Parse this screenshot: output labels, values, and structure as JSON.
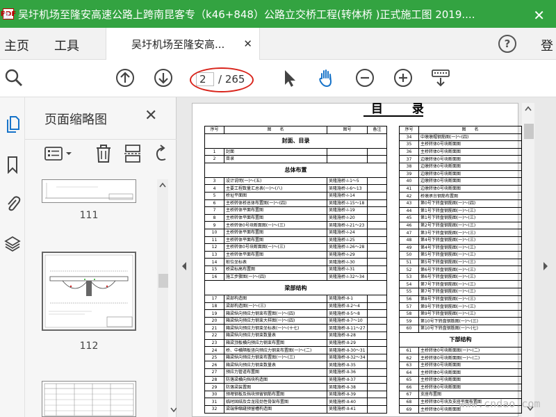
{
  "window": {
    "title": "吴圩机场至隆安高速公路上跨南昆客专（k46+848）公路立交桥工程(转体桥 )正式施工图 2019....",
    "app_icon": "PDF",
    "close_glyph": "✕",
    "corner_watermark": "建"
  },
  "menu": {
    "home": "主页",
    "tools": "工具",
    "doc_tab": "吴圩机场至隆安高...",
    "doc_tab_close": "✕",
    "help": "?",
    "login": "登"
  },
  "toolbar": {
    "current_page": "2",
    "total_pages": "/ 265"
  },
  "thumbnails": {
    "title": "页面缩略图",
    "close": "✕",
    "pages": [
      "111",
      "112"
    ]
  },
  "document": {
    "heading": "目 录",
    "left_headers": [
      "序号",
      "图　　名",
      "图号",
      "备注"
    ],
    "right_headers": [
      "序号",
      "图　　名"
    ],
    "left_rows": [
      {
        "section": "封面、目录"
      },
      {
        "no": "1",
        "name": "封面",
        "code": ""
      },
      {
        "no": "2",
        "name": "目录",
        "code": ""
      },
      {
        "section": "总体布置"
      },
      {
        "no": "3",
        "name": "设计说明(一)～(五)",
        "code": "吴隆施桥-Ⅰ-1～5"
      },
      {
        "no": "4",
        "name": "主要工程数量汇总表(一)～(八)",
        "code": "吴隆施桥-Ⅰ-6～13"
      },
      {
        "no": "5",
        "name": "桥址平面图",
        "code": "吴隆施桥-Ⅰ-14"
      },
      {
        "no": "6",
        "name": "主桥转体桥总体布置图(一)～(四)",
        "code": "吴隆施桥-Ⅰ-15～18"
      },
      {
        "no": "7",
        "name": "主桥转体平面布置图",
        "code": "吴隆施桥-Ⅰ-19"
      },
      {
        "no": "8",
        "name": "主桥转体平面布置图",
        "code": "吴隆施桥-Ⅰ-20"
      },
      {
        "no": "9",
        "name": "主桥转体0号块断面图(一)～(三)",
        "code": "吴隆施桥-Ⅰ-21～23"
      },
      {
        "no": "10",
        "name": "主桥转体平面布置图",
        "code": "吴隆施桥-Ⅰ-24"
      },
      {
        "no": "11",
        "name": "主桥转体平面布置图",
        "code": "吴隆施桥-Ⅰ-25"
      },
      {
        "no": "12",
        "name": "主桥转体0号块断面图(一)～(三)",
        "code": "吴隆施桥-Ⅰ-26～28"
      },
      {
        "no": "13",
        "name": "主桥转体平面布置图",
        "code": "吴隆施桥-Ⅰ-29"
      },
      {
        "no": "14",
        "name": "桩位坐标表",
        "code": "吴隆施桥-Ⅰ-30"
      },
      {
        "no": "15",
        "name": "桥梁标高布置图",
        "code": "吴隆施桥-Ⅰ-31"
      },
      {
        "no": "16",
        "name": "施工步骤图(一)～(四)",
        "code": "吴隆施桥-Ⅰ-32～34"
      },
      {
        "section": "梁部结构"
      },
      {
        "no": "17",
        "name": "梁部构造图",
        "code": "吴隆施桥-Ⅱ-1"
      },
      {
        "no": "18",
        "name": "梁部构造图(一)～(三)",
        "code": "吴隆施桥-Ⅱ-2～4"
      },
      {
        "no": "19",
        "name": "箱梁纵向预应力钢束布置图(一)～(四)",
        "code": "吴隆施桥-Ⅱ-5～8"
      },
      {
        "no": "20",
        "name": "箱梁纵向预应力钢束大样图(一)～(四)",
        "code": "吴隆施桥-Ⅱ-7～10"
      },
      {
        "no": "21",
        "name": "箱梁纵向预应力钢束坐标表(一)～(十七)",
        "code": "吴隆施桥-Ⅱ-11～27"
      },
      {
        "no": "22",
        "name": "箱梁纵向预应力钢束数量表",
        "code": "吴隆施桥-Ⅱ-28"
      },
      {
        "no": "23",
        "name": "箱梁顶板横向预应力钢束布置图",
        "code": "吴隆施桥-Ⅱ-29"
      },
      {
        "no": "24",
        "name": "桥、中横隔板竖向预应力钢束布置图(一)～(二)",
        "code": "吴隆施桥-Ⅱ-30～31"
      },
      {
        "no": "25",
        "name": "箱梁纵向预应力钢束布置图(一)～(三)",
        "code": "吴隆施桥-Ⅱ-32～34"
      },
      {
        "no": "26",
        "name": "箱梁纵向预应力钢束数量表",
        "code": "吴隆施桥-Ⅱ-35"
      },
      {
        "no": "27",
        "name": "预应力管道布置图",
        "code": "吴隆施桥-Ⅱ-36"
      },
      {
        "no": "28",
        "name": "防落梁横向挡块构造图",
        "code": "吴隆施桥-Ⅱ-37"
      },
      {
        "no": "29",
        "name": "防落梁装置图",
        "code": "吴隆施桥-Ⅱ-38"
      },
      {
        "no": "30",
        "name": "预埋钢板及挡块预留钢筋布置图",
        "code": "吴隆施桥-Ⅱ-39"
      },
      {
        "no": "31",
        "name": "临时固结及合龙段劲性骨架布置图",
        "code": "吴隆施桥-Ⅱ-40"
      },
      {
        "no": "32",
        "name": "梁端伸缩缝预留槽构造图",
        "code": "吴隆施桥-Ⅱ-41"
      }
    ],
    "right_rows": [
      {
        "no": "34",
        "name": "中墩墩帽钢筋图(一)～(四)"
      },
      {
        "no": "35",
        "name": "主桥转体0号块断面图"
      },
      {
        "no": "36",
        "name": "主桥转体0号块断面图"
      },
      {
        "no": "37",
        "name": "边墩转体0号块断面图"
      },
      {
        "no": "38",
        "name": "边墩转体0号块断面图"
      },
      {
        "no": "39",
        "name": "边墩转体0号块断面图"
      },
      {
        "no": "40",
        "name": "边墩转体0号块断面图"
      },
      {
        "no": "41",
        "name": "边墩转体0号块断面图"
      },
      {
        "no": "42",
        "name": "桥墩承台钢筋布置图"
      },
      {
        "no": "43",
        "name": "第0号下转盘钢筋图(一)～(四)"
      },
      {
        "no": "44",
        "name": "第1号下转盘钢筋图(一)～(三)"
      },
      {
        "no": "45",
        "name": "第1号下转盘钢筋图(一)～(三)"
      },
      {
        "no": "46",
        "name": "第2号下转盘钢筋图(一)～(三)"
      },
      {
        "no": "47",
        "name": "第3号下转盘钢筋图(一)～(三)"
      },
      {
        "no": "48",
        "name": "第4号下转盘钢筋图(一)～(三)"
      },
      {
        "no": "49",
        "name": "第4号下转盘钢筋图(一)～(三)"
      },
      {
        "no": "50",
        "name": "第5号下转盘钢筋图(一)～(三)"
      },
      {
        "no": "51",
        "name": "第5号下转盘钢筋图(一)～(三)"
      },
      {
        "no": "52",
        "name": "第6号下转盘钢筋图(一)～(三)"
      },
      {
        "no": "53",
        "name": "第6号下转盘钢筋图(一)～(三)"
      },
      {
        "no": "54",
        "name": "第7号下转盘钢筋图(一)～(三)"
      },
      {
        "no": "55",
        "name": "第7号下转盘钢筋图(一)～(三)"
      },
      {
        "no": "56",
        "name": "第8号下转盘钢筋图(一)～(三)"
      },
      {
        "no": "57",
        "name": "第9号下转盘钢筋图(一)～(三)"
      },
      {
        "no": "58",
        "name": "第9号下转盘钢筋图(一)～(三)"
      },
      {
        "no": "59",
        "name": "第10号下转盘钢筋图(一)～(三)"
      },
      {
        "no": "60",
        "name": "第10号下转盘钢筋图(一)～(七)"
      },
      {
        "section": "下部结构"
      },
      {
        "no": "61",
        "name": "主桥转体0号块断面图(一)～(二)"
      },
      {
        "no": "62",
        "name": "主桥转体0号块断面图(一)～(二)"
      },
      {
        "no": "63",
        "name": "主桥转体0号块断面图"
      },
      {
        "no": "64",
        "name": "主桥转体0号块断面图"
      },
      {
        "no": "65",
        "name": "主桥转体0号块断面图"
      },
      {
        "no": "66",
        "name": "主桥转体0号块断面图"
      },
      {
        "no": "67",
        "name": "支座布置图"
      },
      {
        "no": "68",
        "name": "主桥转体0号块及支座平面布置图"
      },
      {
        "no": "69",
        "name": "主桥转体0号块断面图"
      }
    ]
  },
  "watermark": "www.cndao.com"
}
